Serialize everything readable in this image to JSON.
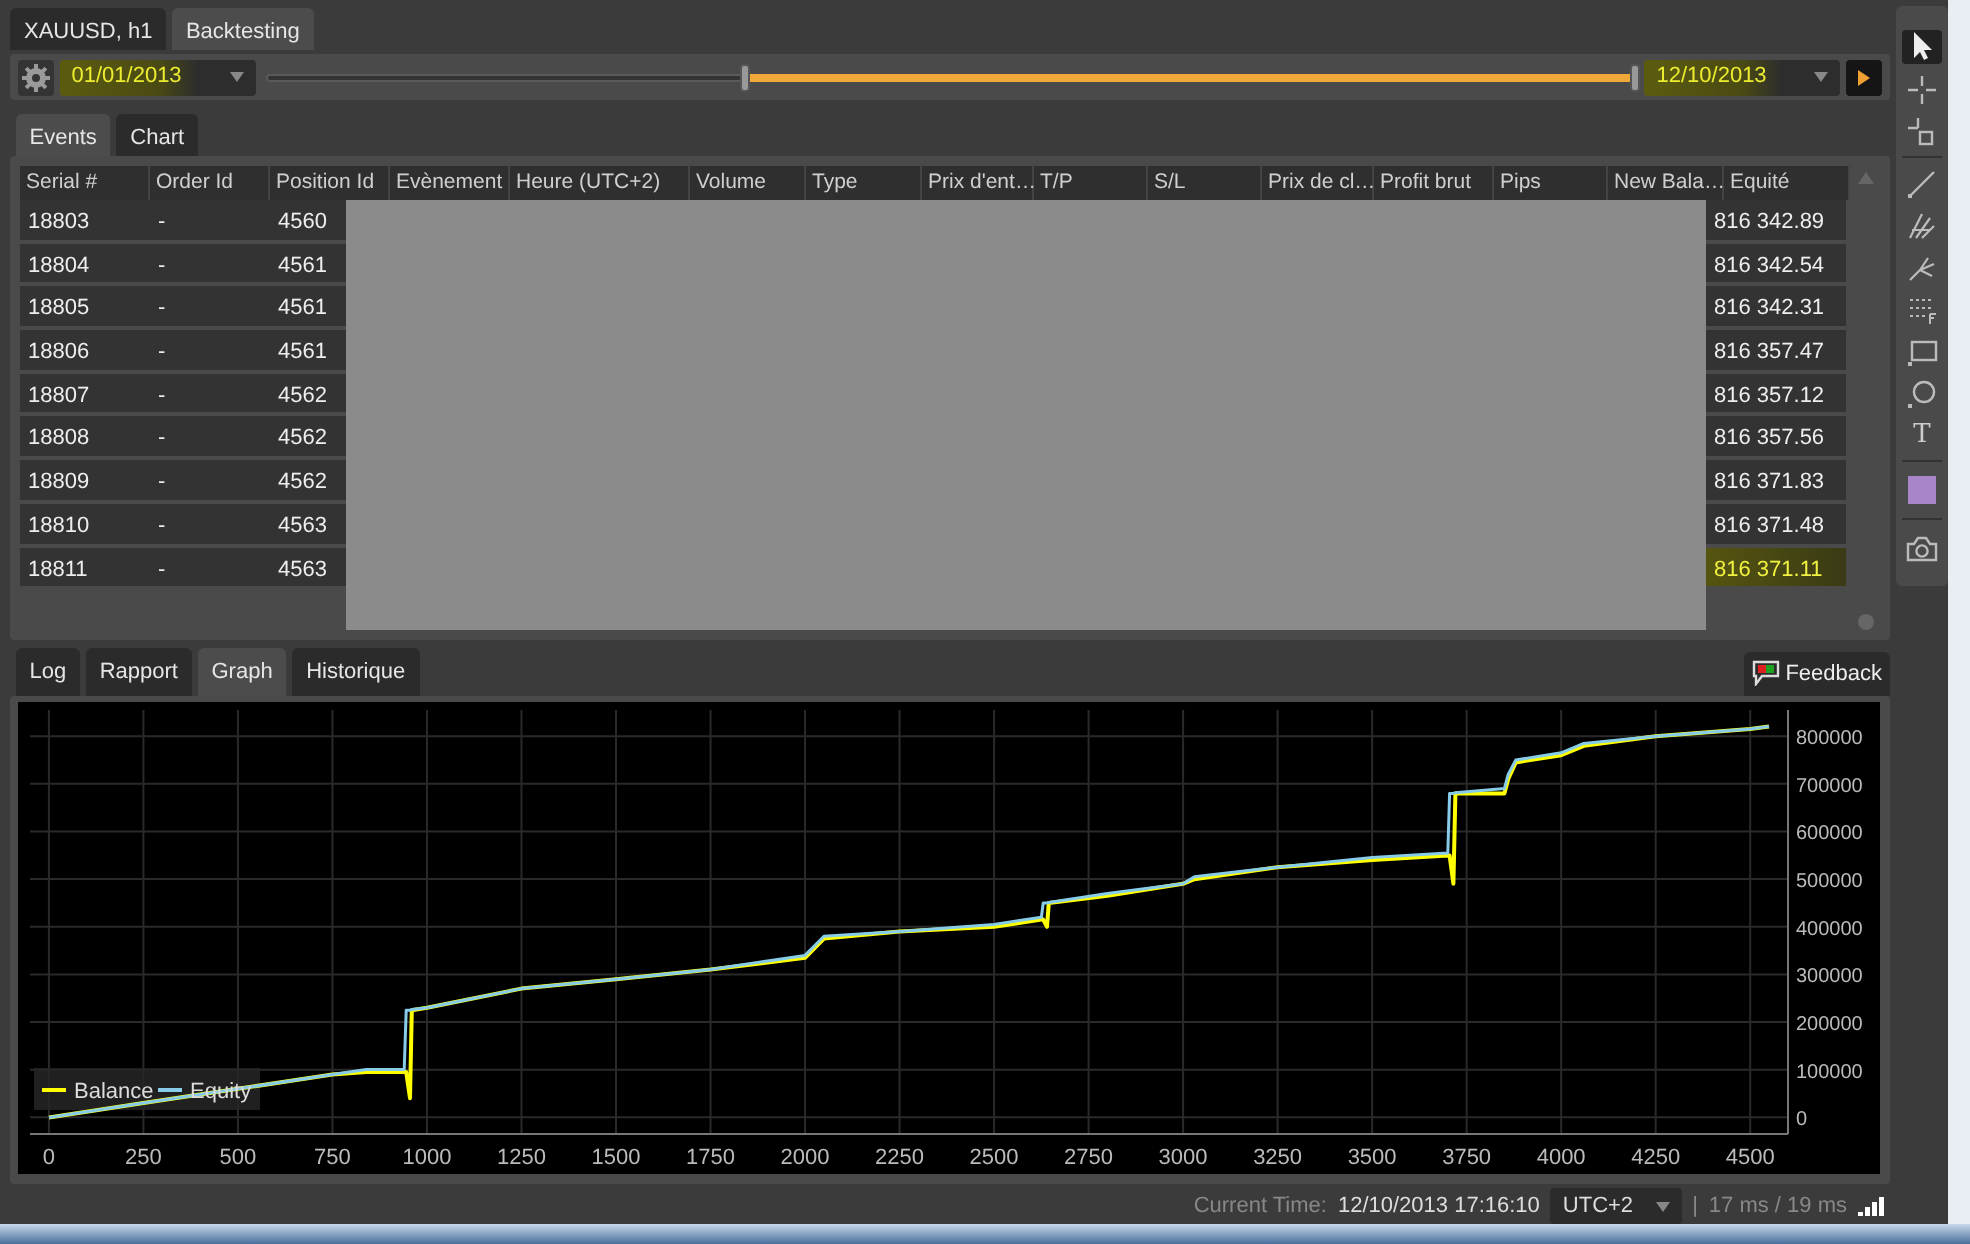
{
  "window_tabs": [
    {
      "label": "XAUUSD, h1",
      "selected": false
    },
    {
      "label": "Backtesting",
      "selected": true
    }
  ],
  "range": {
    "start_date": "01/01/2013",
    "end_date": "12/10/2013",
    "start_highlighted": true,
    "end_highlighted": true,
    "handles": [
      {
        "level": 0.35
      },
      {
        "level": 1
      }
    ]
  },
  "panel_tabs": [
    {
      "label": "Events",
      "selected": true
    },
    {
      "label": "Chart",
      "selected": false
    }
  ],
  "events_table": {
    "columns": [
      "Serial #",
      "Order Id",
      "Position Id",
      "Evènement",
      "Heure (UTC+2)",
      "Volume",
      "Type",
      "Prix d'ent…",
      "T/P",
      "S/L",
      "Prix de cl…",
      "Profit brut",
      "Pips",
      "New Bala…",
      "Equité"
    ],
    "rows": [
      {
        "serial": "18803",
        "order_id": "-",
        "position_id": "4560",
        "equity": "816 342.89",
        "highlighted": false
      },
      {
        "serial": "18804",
        "order_id": "-",
        "position_id": "4561",
        "equity": "816 342.54",
        "highlighted": false
      },
      {
        "serial": "18805",
        "order_id": "-",
        "position_id": "4561",
        "equity": "816 342.31",
        "highlighted": false
      },
      {
        "serial": "18806",
        "order_id": "-",
        "position_id": "4561",
        "equity": "816 357.47",
        "highlighted": false
      },
      {
        "serial": "18807",
        "order_id": "-",
        "position_id": "4562",
        "equity": "816 357.12",
        "highlighted": false
      },
      {
        "serial": "18808",
        "order_id": "-",
        "position_id": "4562",
        "equity": "816 357.56",
        "highlighted": false
      },
      {
        "serial": "18809",
        "order_id": "-",
        "position_id": "4562",
        "equity": "816 371.83",
        "highlighted": false
      },
      {
        "serial": "18810",
        "order_id": "-",
        "position_id": "4563",
        "equity": "816 371.48",
        "highlighted": false
      },
      {
        "serial": "18811",
        "order_id": "-",
        "position_id": "4563",
        "equity": "816 371.11",
        "highlighted": true
      }
    ]
  },
  "result_tabs": [
    {
      "label": "Log",
      "selected": false
    },
    {
      "label": "Rapport",
      "selected": false
    },
    {
      "label": "Graph",
      "selected": true
    },
    {
      "label": "Historique",
      "selected": false
    }
  ],
  "feedback_button": "Feedback",
  "graph": {
    "chart_data": {
      "type": "line",
      "grid": true,
      "legend": true,
      "x": [
        0,
        250,
        500,
        750,
        840,
        940,
        945,
        955,
        960,
        1000,
        1250,
        1500,
        1750,
        2000,
        2050,
        2250,
        2500,
        2625,
        2630,
        2640,
        2645,
        2800,
        3000,
        3030,
        3250,
        3500,
        3700,
        3705,
        3715,
        3720,
        3850,
        3860,
        3880,
        4000,
        4060,
        4250,
        4500,
        4550
      ],
      "series": [
        {
          "name": "Balance",
          "color": "#ffff00",
          "values": [
            0,
            30000,
            60000,
            90000,
            95000,
            95000,
            95000,
            40000,
            225000,
            230000,
            270000,
            290000,
            310000,
            335000,
            375000,
            390000,
            400000,
            415000,
            415000,
            400000,
            450000,
            465000,
            490000,
            500000,
            525000,
            540000,
            550000,
            550000,
            490000,
            680000,
            680000,
            710000,
            745000,
            760000,
            780000,
            800000,
            815000,
            820000
          ]
        },
        {
          "name": "Equity",
          "color": "#87cce8",
          "values": [
            0,
            30000,
            60000,
            90000,
            100000,
            100000,
            225000,
            225000,
            226000,
            230000,
            270000,
            290000,
            310000,
            340000,
            380000,
            390000,
            405000,
            420000,
            450000,
            450000,
            451000,
            470000,
            490000,
            505000,
            525000,
            545000,
            555000,
            680000,
            680000,
            681000,
            690000,
            720000,
            750000,
            765000,
            785000,
            800000,
            815000,
            820000
          ]
        }
      ],
      "xlim": [
        -50,
        4600
      ],
      "ylim": [
        -35000,
        855000
      ],
      "xticks": [
        0,
        250,
        500,
        750,
        1000,
        1250,
        1500,
        1750,
        2000,
        2250,
        2500,
        2750,
        3000,
        3250,
        3500,
        3750,
        4000,
        4250,
        4500
      ],
      "yticks": [
        0,
        100000,
        200000,
        300000,
        400000,
        500000,
        600000,
        700000,
        800000
      ]
    }
  },
  "status_bar": {
    "label": "Current Time:",
    "time": "12/10/2013 17:16:10",
    "timezone": "UTC+2",
    "separator": "|",
    "latency": "17 ms / 19 ms"
  },
  "tools": [
    {
      "kind": "pointer",
      "selected": true
    },
    {
      "kind": "crosshair",
      "selected": false
    },
    {
      "kind": "crosshair-box",
      "selected": false
    },
    {
      "kind": "divider"
    },
    {
      "kind": "line",
      "selected": false
    },
    {
      "kind": "pitchfork",
      "selected": false
    },
    {
      "kind": "fork",
      "selected": false
    },
    {
      "kind": "grid",
      "selected": false
    },
    {
      "kind": "rectangle",
      "selected": false
    },
    {
      "kind": "ellipse",
      "selected": false
    },
    {
      "kind": "text",
      "label": "T",
      "selected": false
    },
    {
      "kind": "divider"
    },
    {
      "kind": "swatch",
      "selected": false
    },
    {
      "kind": "divider"
    },
    {
      "kind": "camera",
      "selected": false
    }
  ]
}
